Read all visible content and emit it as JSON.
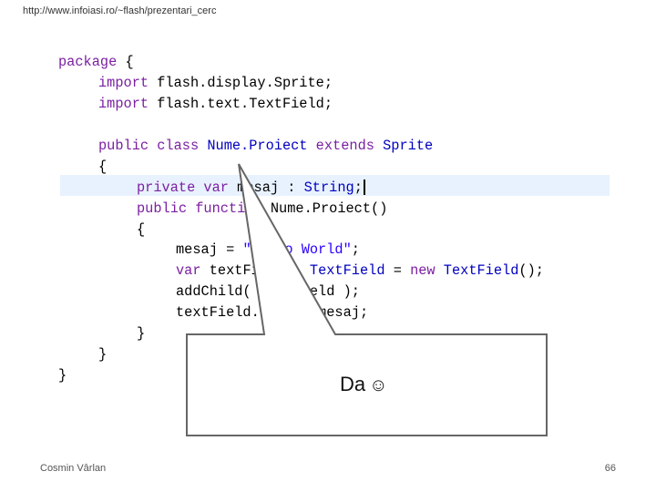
{
  "header": {
    "url": "http://www.infoiasi.ro/~flash/prezentari_cerc"
  },
  "code": {
    "lines": [
      {
        "kw": "package",
        "rest": " {"
      },
      {
        "kw": "import",
        "rest": " flash.display.Sprite;"
      },
      {
        "kw": "import",
        "rest": " flash.text.TextField;"
      },
      {
        "kw": "public class",
        "cls": " Nume.Proiect",
        "kw2": " extends",
        "cls2": " Sprite"
      },
      {
        "rest": "{"
      },
      {
        "kw": "private var",
        "rest": " mesaj : ",
        "type": "String",
        "end": ";"
      },
      {
        "kw": "public function",
        "rest": " Nume.Proiect()"
      },
      {
        "rest": "{"
      },
      {
        "rest": "mesaj = ",
        "str": "\"Hello World\"",
        "end": ";"
      },
      {
        "kw": "var",
        "rest": " textField : ",
        "type": "TextField",
        "rest2": " = ",
        "kw2": "new",
        "type2": " TextField",
        "end": "();"
      },
      {
        "rest": "addChild( textField );"
      },
      {
        "rest": "textField.text = mesaj;"
      },
      {
        "rest": "}"
      },
      {
        "rest": "}"
      },
      {
        "rest": "}"
      }
    ]
  },
  "callout": {
    "text": "Da",
    "emoji": "☺"
  },
  "footer": {
    "author": "Cosmin Vârlan",
    "page": "66"
  }
}
